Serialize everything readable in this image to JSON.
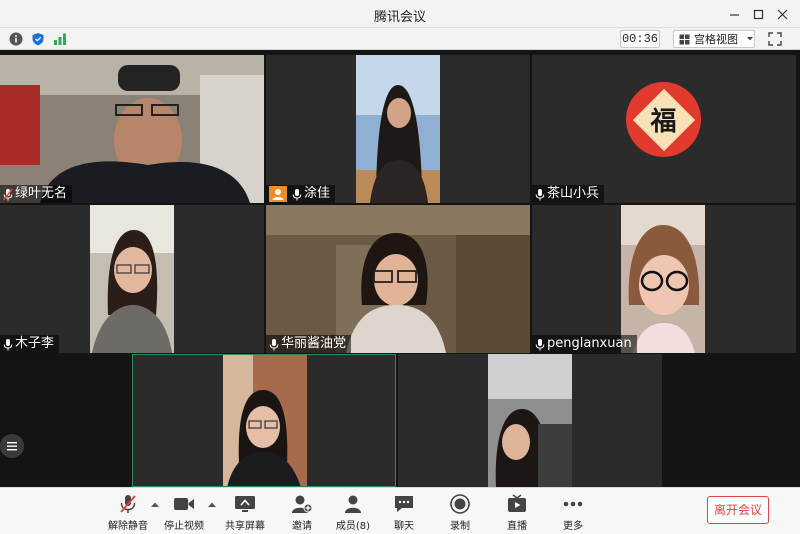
{
  "window": {
    "title": "腾讯会议"
  },
  "infobar": {
    "icons": [
      "info-icon",
      "shield-icon",
      "signal-icon"
    ],
    "timer": "00:36",
    "view_label": "宫格视图",
    "fullscreen_icon": "fullscreen-icon"
  },
  "participants": [
    {
      "name": "绿叶无名",
      "mic": "muted"
    },
    {
      "name": "涂佳",
      "mic": "on",
      "host": true
    },
    {
      "name": "茶山小兵",
      "mic": "on",
      "avatar_glyph": "福"
    },
    {
      "name": "木子李",
      "mic": "on"
    },
    {
      "name": "华丽酱油党",
      "mic": "on"
    },
    {
      "name": "penglanxuan",
      "mic": "on"
    }
  ],
  "toolbar": {
    "mute": "解除静音",
    "video": "停止视频",
    "share": "共享屏幕",
    "invite": "邀请",
    "members": "成员(8)",
    "chat": "聊天",
    "record": "录制",
    "live": "直播",
    "more": "更多",
    "leave": "离开会议"
  },
  "colors": {
    "accent": "#1a6fde",
    "danger": "#e0473f",
    "speaking_border": "#2e8b57",
    "host_badge": "#f08c2a"
  }
}
